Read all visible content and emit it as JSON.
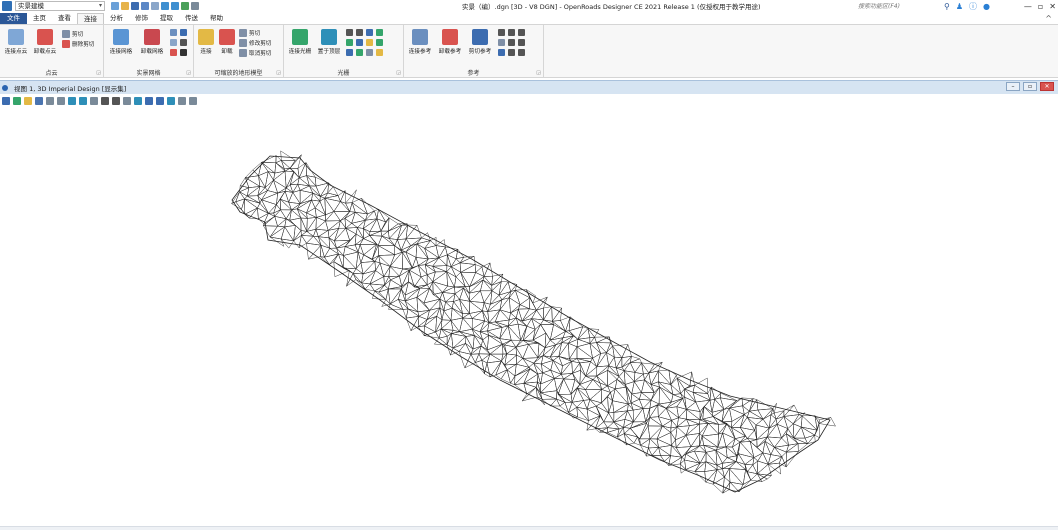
{
  "workspace": {
    "selected": "实景建模"
  },
  "window": {
    "title": "实景（编）.dgn [3D - V8 DGN] - OpenRoads Designer CE 2021 Release 1 (仅授权用于教学用途)",
    "search_placeholder": "搜索功能区(F4)"
  },
  "tabs": [
    "文件",
    "主页",
    "查看",
    "连接",
    "分析",
    "修饰",
    "提取",
    "传送",
    "帮助"
  ],
  "active_tab": "连接",
  "ribbon": {
    "groups": [
      {
        "label": "点云",
        "buttons": [
          "连接点云",
          "卸载点云"
        ],
        "small": [
          "剪切",
          "删除剪切"
        ]
      },
      {
        "label": "实景网格",
        "buttons": [
          "连接网格",
          "卸载网格"
        ]
      },
      {
        "label": "可缩放的地形模型",
        "buttons": [
          "连接",
          "卸载"
        ],
        "small": [
          "剪切",
          "修改剪切",
          "取消剪切"
        ]
      },
      {
        "label": "光栅",
        "buttons": [
          "连接光栅",
          "置于顶层"
        ]
      },
      {
        "label": "参考",
        "buttons": [
          "连接参考",
          "卸载参考",
          "剪切参考"
        ]
      }
    ]
  },
  "view": {
    "title": "视图 1, 3D Imperial Design [显示集]"
  },
  "colors": {
    "file_tab": "#2b5797",
    "view_header": "#d6e4f2",
    "mesh_stroke": "#222222"
  },
  "icons": [
    "app-icon",
    "save-icon",
    "open-icon",
    "undo-icon",
    "redo-icon",
    "search-icon",
    "notification-icon",
    "help-icon",
    "user-icon",
    "minimize-icon",
    "restore-icon",
    "close-icon"
  ]
}
